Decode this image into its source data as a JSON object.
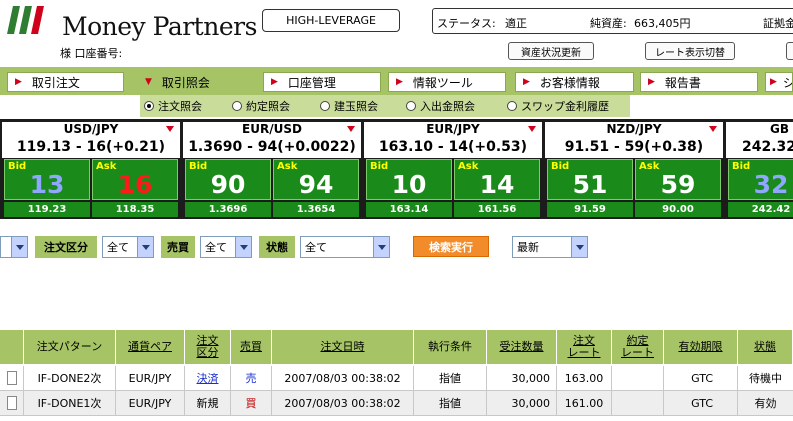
{
  "header": {
    "brand": "Money Partners",
    "account_label": "様 口座番号:",
    "high_leverage": "HIGH-LEVERAGE",
    "status_label": "ステータス:",
    "status_value": "適正",
    "net_assets_label": "純資産:",
    "net_assets_value": "663,405円",
    "margin_label": "証拠金",
    "refresh_btn": "資産状況更新",
    "rate_toggle_btn": "レート表示切替",
    "logo_colors": [
      "#2f7d32",
      "#2f7d32",
      "#d0021b"
    ]
  },
  "nav": {
    "tabs": [
      "取引注文",
      "取引照会",
      "口座管理",
      "情報ツール",
      "お客様情報",
      "報告書",
      "シ"
    ],
    "active_index": 1,
    "subtabs": [
      "注文照会",
      "約定照会",
      "建玉照会",
      "入出金照会",
      "スワップ金利履歴"
    ],
    "sub_selected_index": 0
  },
  "rates": {
    "bid_label": "Bid",
    "ask_label": "Ask",
    "colors": {
      "bid_big": "#8ea8ff",
      "ask_big": "#ff1a1a",
      "other_big": "#ffffff"
    },
    "panels": [
      {
        "pair": "USD/JPY",
        "rate": "119.13 - 16(+0.21)",
        "bid": "13",
        "ask": "16",
        "bid_sub": "119.23",
        "ask_sub": "118.35",
        "bid_color": "bid_big",
        "ask_color": "ask_big"
      },
      {
        "pair": "EUR/USD",
        "rate": "1.3690 - 94(+0.0022)",
        "bid": "90",
        "ask": "94",
        "bid_sub": "1.3696",
        "ask_sub": "1.3654",
        "bid_color": "other_big",
        "ask_color": "other_big"
      },
      {
        "pair": "EUR/JPY",
        "rate": "163.10 - 14(+0.53)",
        "bid": "10",
        "ask": "14",
        "bid_sub": "163.14",
        "ask_sub": "161.56",
        "bid_color": "other_big",
        "ask_color": "other_big"
      },
      {
        "pair": "NZD/JPY",
        "rate": "91.51 - 59(+0.38)",
        "bid": "51",
        "ask": "59",
        "bid_sub": "91.59",
        "ask_sub": "90.00",
        "bid_color": "other_big",
        "ask_color": "other_big"
      },
      {
        "pair": "GB",
        "rate": "242.32",
        "bid": "32",
        "ask": "",
        "bid_sub": "242.42",
        "ask_sub": "",
        "bid_color": "bid_big",
        "ask_color": "other_big"
      }
    ]
  },
  "filters": {
    "order_type_label": "注文区分",
    "order_type_value": "全て",
    "buysell_label": "売買",
    "buysell_value": "全て",
    "state_label": "状態",
    "state_value": "全て",
    "search_btn": "検索実行",
    "sort_value": "最新"
  },
  "table": {
    "headers": [
      "注文パターン",
      "通貨ペア",
      "注文\n区分",
      "売買",
      "注文日時",
      "執行条件",
      "受注数量",
      "注文\nレート",
      "約定\nレート",
      "有効期限",
      "状態"
    ],
    "rows": [
      {
        "pattern": "IF-DONE2次",
        "pair": "EUR/JPY",
        "type": "決済",
        "side": "売",
        "datetime": "2007/08/03 00:38:02",
        "condition": "指値",
        "qty": "30,000",
        "rate": "163.00",
        "exec_rate": "",
        "expiry": "GTC",
        "state": "待機中"
      },
      {
        "pattern": "IF-DONE1次",
        "pair": "EUR/JPY",
        "type": "新規",
        "side": "買",
        "datetime": "2007/08/03 00:38:02",
        "condition": "指値",
        "qty": "30,000",
        "rate": "161.00",
        "exec_rate": "",
        "expiry": "GTC",
        "state": "有効"
      }
    ],
    "colors": {
      "settle": "#1a2fd0",
      "sell": "#1a2fd0",
      "buy": "#c00000"
    }
  }
}
